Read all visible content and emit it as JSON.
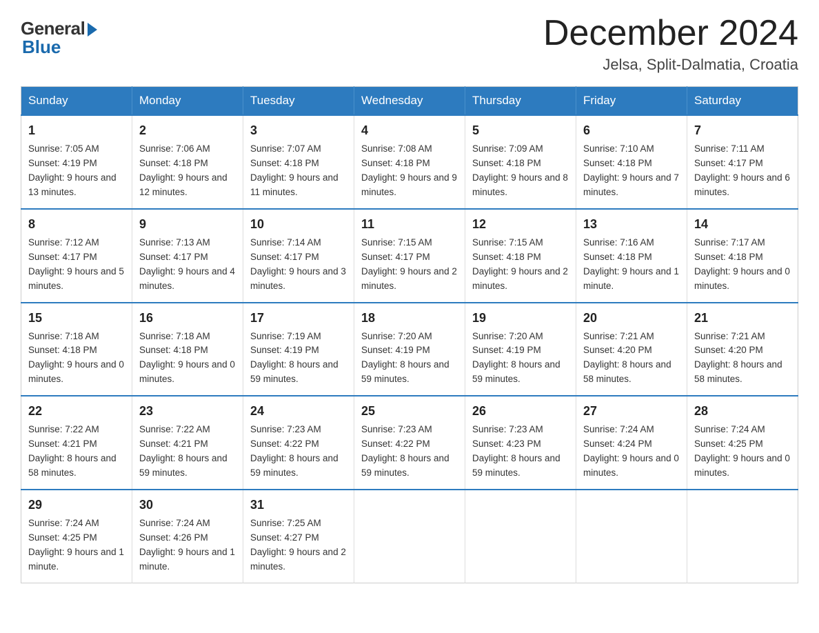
{
  "logo": {
    "general": "General",
    "blue": "Blue"
  },
  "title": {
    "month": "December 2024",
    "location": "Jelsa, Split-Dalmatia, Croatia"
  },
  "headers": [
    "Sunday",
    "Monday",
    "Tuesday",
    "Wednesday",
    "Thursday",
    "Friday",
    "Saturday"
  ],
  "weeks": [
    [
      {
        "day": "1",
        "sunrise": "7:05 AM",
        "sunset": "4:19 PM",
        "daylight": "9 hours and 13 minutes."
      },
      {
        "day": "2",
        "sunrise": "7:06 AM",
        "sunset": "4:18 PM",
        "daylight": "9 hours and 12 minutes."
      },
      {
        "day": "3",
        "sunrise": "7:07 AM",
        "sunset": "4:18 PM",
        "daylight": "9 hours and 11 minutes."
      },
      {
        "day": "4",
        "sunrise": "7:08 AM",
        "sunset": "4:18 PM",
        "daylight": "9 hours and 9 minutes."
      },
      {
        "day": "5",
        "sunrise": "7:09 AM",
        "sunset": "4:18 PM",
        "daylight": "9 hours and 8 minutes."
      },
      {
        "day": "6",
        "sunrise": "7:10 AM",
        "sunset": "4:18 PM",
        "daylight": "9 hours and 7 minutes."
      },
      {
        "day": "7",
        "sunrise": "7:11 AM",
        "sunset": "4:17 PM",
        "daylight": "9 hours and 6 minutes."
      }
    ],
    [
      {
        "day": "8",
        "sunrise": "7:12 AM",
        "sunset": "4:17 PM",
        "daylight": "9 hours and 5 minutes."
      },
      {
        "day": "9",
        "sunrise": "7:13 AM",
        "sunset": "4:17 PM",
        "daylight": "9 hours and 4 minutes."
      },
      {
        "day": "10",
        "sunrise": "7:14 AM",
        "sunset": "4:17 PM",
        "daylight": "9 hours and 3 minutes."
      },
      {
        "day": "11",
        "sunrise": "7:15 AM",
        "sunset": "4:17 PM",
        "daylight": "9 hours and 2 minutes."
      },
      {
        "day": "12",
        "sunrise": "7:15 AM",
        "sunset": "4:18 PM",
        "daylight": "9 hours and 2 minutes."
      },
      {
        "day": "13",
        "sunrise": "7:16 AM",
        "sunset": "4:18 PM",
        "daylight": "9 hours and 1 minute."
      },
      {
        "day": "14",
        "sunrise": "7:17 AM",
        "sunset": "4:18 PM",
        "daylight": "9 hours and 0 minutes."
      }
    ],
    [
      {
        "day": "15",
        "sunrise": "7:18 AM",
        "sunset": "4:18 PM",
        "daylight": "9 hours and 0 minutes."
      },
      {
        "day": "16",
        "sunrise": "7:18 AM",
        "sunset": "4:18 PM",
        "daylight": "9 hours and 0 minutes."
      },
      {
        "day": "17",
        "sunrise": "7:19 AM",
        "sunset": "4:19 PM",
        "daylight": "8 hours and 59 minutes."
      },
      {
        "day": "18",
        "sunrise": "7:20 AM",
        "sunset": "4:19 PM",
        "daylight": "8 hours and 59 minutes."
      },
      {
        "day": "19",
        "sunrise": "7:20 AM",
        "sunset": "4:19 PM",
        "daylight": "8 hours and 59 minutes."
      },
      {
        "day": "20",
        "sunrise": "7:21 AM",
        "sunset": "4:20 PM",
        "daylight": "8 hours and 58 minutes."
      },
      {
        "day": "21",
        "sunrise": "7:21 AM",
        "sunset": "4:20 PM",
        "daylight": "8 hours and 58 minutes."
      }
    ],
    [
      {
        "day": "22",
        "sunrise": "7:22 AM",
        "sunset": "4:21 PM",
        "daylight": "8 hours and 58 minutes."
      },
      {
        "day": "23",
        "sunrise": "7:22 AM",
        "sunset": "4:21 PM",
        "daylight": "8 hours and 59 minutes."
      },
      {
        "day": "24",
        "sunrise": "7:23 AM",
        "sunset": "4:22 PM",
        "daylight": "8 hours and 59 minutes."
      },
      {
        "day": "25",
        "sunrise": "7:23 AM",
        "sunset": "4:22 PM",
        "daylight": "8 hours and 59 minutes."
      },
      {
        "day": "26",
        "sunrise": "7:23 AM",
        "sunset": "4:23 PM",
        "daylight": "8 hours and 59 minutes."
      },
      {
        "day": "27",
        "sunrise": "7:24 AM",
        "sunset": "4:24 PM",
        "daylight": "9 hours and 0 minutes."
      },
      {
        "day": "28",
        "sunrise": "7:24 AM",
        "sunset": "4:25 PM",
        "daylight": "9 hours and 0 minutes."
      }
    ],
    [
      {
        "day": "29",
        "sunrise": "7:24 AM",
        "sunset": "4:25 PM",
        "daylight": "9 hours and 1 minute."
      },
      {
        "day": "30",
        "sunrise": "7:24 AM",
        "sunset": "4:26 PM",
        "daylight": "9 hours and 1 minute."
      },
      {
        "day": "31",
        "sunrise": "7:25 AM",
        "sunset": "4:27 PM",
        "daylight": "9 hours and 2 minutes."
      },
      null,
      null,
      null,
      null
    ]
  ]
}
